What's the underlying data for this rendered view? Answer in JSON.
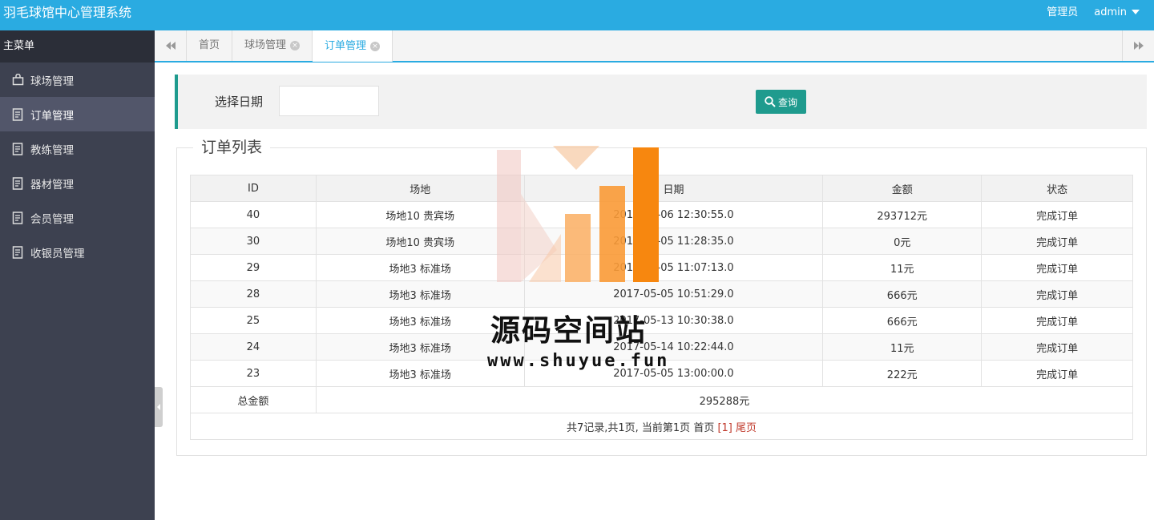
{
  "header": {
    "app_title": "羽毛球馆中心管理系统",
    "role_label": "管理员",
    "username": "admin"
  },
  "sidebar": {
    "title": "主菜单",
    "items": [
      {
        "label": "球场管理",
        "icon": "bag-icon"
      },
      {
        "label": "订单管理",
        "icon": "document-icon",
        "active": true
      },
      {
        "label": "教练管理",
        "icon": "document-icon"
      },
      {
        "label": "器材管理",
        "icon": "document-icon"
      },
      {
        "label": "会员管理",
        "icon": "document-icon"
      },
      {
        "label": "收银员管理",
        "icon": "document-icon"
      }
    ]
  },
  "tabs": [
    {
      "label": "首页",
      "closable": false
    },
    {
      "label": "球场管理",
      "closable": true
    },
    {
      "label": "订单管理",
      "closable": true,
      "active": true
    }
  ],
  "search": {
    "date_label": "选择日期",
    "date_value": "",
    "query_label": "查询"
  },
  "orders": {
    "legend": "订单列表",
    "columns": [
      "ID",
      "场地",
      "日期",
      "金额",
      "状态"
    ],
    "rows": [
      [
        "40",
        "场地10 贵宾场",
        "2017-05-06 12:30:55.0",
        "293712元",
        "完成订单"
      ],
      [
        "30",
        "场地10 贵宾场",
        "2017-05-05 11:28:35.0",
        "0元",
        "完成订单"
      ],
      [
        "29",
        "场地3 标准场",
        "2017-05-05 11:07:13.0",
        "11元",
        "完成订单"
      ],
      [
        "28",
        "场地3 标准场",
        "2017-05-05 10:51:29.0",
        "666元",
        "完成订单"
      ],
      [
        "25",
        "场地3 标准场",
        "2017-05-13 10:30:38.0",
        "666元",
        "完成订单"
      ],
      [
        "24",
        "场地3 标准场",
        "2017-05-14 10:22:44.0",
        "11元",
        "完成订单"
      ],
      [
        "23",
        "场地3 标准场",
        "2017-05-05 13:00:00.0",
        "222元",
        "完成订单"
      ]
    ],
    "total_label": "总金额",
    "total_value": "295288元",
    "pager": {
      "summary": "共7记录,共1页, 当前第1页 ",
      "first": "首页",
      "current": " [1] ",
      "last": "尾页"
    }
  },
  "watermark": {
    "text": "源码空间站",
    "url": "www.shuyue.fun"
  },
  "colors": {
    "header_bg": "#2aabe1",
    "sidebar_bg": "#3d4150",
    "accent_teal": "#1f9b8e",
    "watermark_orange": "#f7870f"
  }
}
